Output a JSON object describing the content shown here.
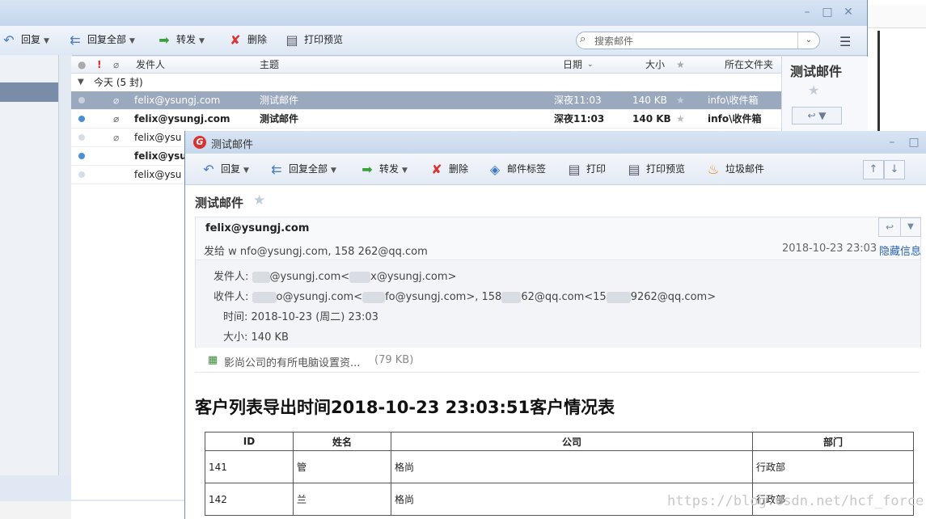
{
  "main_toolbar": {
    "reply": "回复",
    "reply_all": "回复全部",
    "forward": "转发",
    "delete": "删除",
    "print_preview": "打印预览",
    "search_placeholder": "搜索邮件"
  },
  "list_columns": {
    "from": "发件人",
    "subject": "主题",
    "date": "日期",
    "size": "大小",
    "folder": "所在文件夹"
  },
  "group_label": "今天 (5 封)",
  "rows": [
    {
      "from": "felix@ysungj.com",
      "subject": "测试邮件",
      "date": "深夜11:03",
      "size": "140 KB",
      "folder": "info\\收件箱",
      "bold": false,
      "selected": true
    },
    {
      "from": "felix@ysungj.com",
      "subject": "测试邮件",
      "date": "深夜11:03",
      "size": "140 KB",
      "folder": "info\\收件箱",
      "bold": true,
      "selected": false
    },
    {
      "from": "felix@ysu",
      "subject": "",
      "date": "",
      "size": "",
      "folder": "",
      "bold": false,
      "selected": false
    },
    {
      "from": "felix@ysu",
      "subject": "",
      "date": "",
      "size": "",
      "folder": "",
      "bold": true,
      "selected": false
    },
    {
      "from": "felix@ysu",
      "subject": "",
      "date": "",
      "size": "",
      "folder": "",
      "bold": false,
      "selected": false
    }
  ],
  "preview_title": "测试邮件",
  "mail_window": {
    "title": "测试邮件",
    "toolbar": {
      "reply": "回复",
      "reply_all": "回复全部",
      "forward": "转发",
      "delete": "删除",
      "tag": "邮件标签",
      "print": "打印",
      "print_preview": "打印预览",
      "junk": "垃圾邮件"
    },
    "subject": "测试邮件",
    "sender_display": "felix@ysungj.com",
    "to_line": "发给 w     nfo@ysungj.com, 158      262@qq.com",
    "datetime": "2018-10-23 23:03",
    "hide_info": "隐藏信息",
    "from_label": "发件人:",
    "from_value": "@ysungj.com<",
    "from_value2": "x@ysungj.com>",
    "to_label": "收件人:",
    "to_value": "o@ysungj.com<",
    "to_value2": "fo@ysungj.com>, 158",
    "to_value3": "62@qq.com<15",
    "to_value4": "9262@qq.com>",
    "time_label": "时间:",
    "time_value": "2018-10-23 (周二) 23:03",
    "size_label": "大小:",
    "size_value": "140 KB",
    "attachment_name": "影尚公司的有所电脑设置资...",
    "attachment_size": "(79 KB)",
    "body_title": "客户列表导出时间2018-10-23 23:03:51客户情况表",
    "table_headers": [
      "ID",
      "姓名",
      "公司",
      "部门"
    ],
    "table_rows": [
      [
        "141",
        "管",
        "格尚",
        "行政部"
      ],
      [
        "142",
        "兰",
        "格尚",
        "行政部"
      ]
    ],
    "watermark": "https://blog.csdn.net/hcf_force"
  }
}
